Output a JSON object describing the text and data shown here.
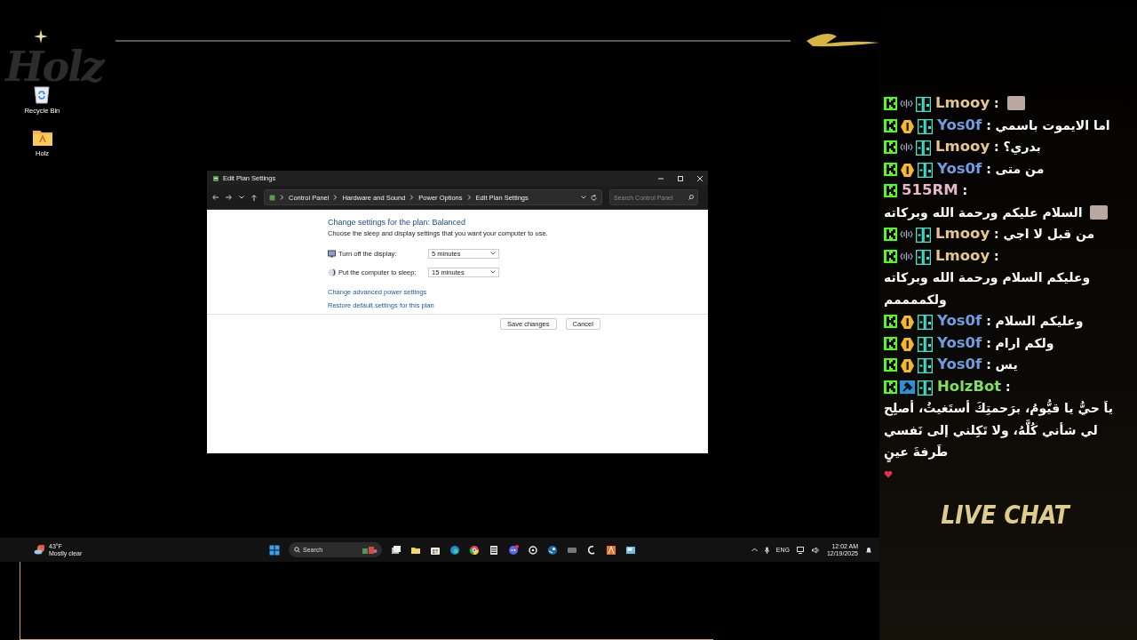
{
  "overlay": {
    "logo": "Holz",
    "live_chat": "LIVE CHAT"
  },
  "desktop": {
    "icons": [
      {
        "label": "Recycle Bin",
        "kind": "recycle"
      },
      {
        "label": "Holz",
        "kind": "folder"
      }
    ]
  },
  "window": {
    "title": "Edit Plan Settings",
    "breadcrumb": [
      "Control Panel",
      "Hardware and Sound",
      "Power Options",
      "Edit Plan Settings"
    ],
    "search": {
      "placeholder": "Search Control Panel"
    },
    "heading": "Change settings for the plan: Balanced",
    "description": "Choose the sleep and display settings that you want your computer to use.",
    "settings": [
      {
        "label": "Turn off the display:",
        "value": "5 minutes",
        "kind": "display"
      },
      {
        "label": "Put the computer to sleep:",
        "value": "15 minutes",
        "kind": "sleep"
      }
    ],
    "links": [
      "Change advanced power settings",
      "Restore default settings for this plan"
    ],
    "buttons": [
      "Save changes",
      "Cancel"
    ]
  },
  "taskbar": {
    "weather": {
      "temperature": "43°F",
      "condition": "Mostly clear"
    },
    "search": {
      "placeholder": "Search"
    },
    "language": "ENG",
    "time": "12:02 AM",
    "date": "12/19/2025"
  },
  "chat": {
    "messages": [
      {
        "badges": [
          {
            "kind": "kick"
          },
          {
            "kind": "sound"
          },
          {
            "kind": "bg"
          }
        ],
        "user": "Lmooy",
        "color": "#e6c68c",
        "separator": ":",
        "emote": {
          "kind": "image"
        }
      },
      {
        "badges": [
          {
            "kind": "kick"
          },
          {
            "kind": "coin"
          },
          {
            "kind": "bg"
          }
        ],
        "user": "Yos0f",
        "color": "#6f9de2",
        "separator": ":",
        "text": "اما الايموت باسمي"
      },
      {
        "badges": [
          {
            "kind": "kick"
          },
          {
            "kind": "sound"
          },
          {
            "kind": "bg"
          }
        ],
        "user": "Lmooy",
        "color": "#e6c68c",
        "separator": ":",
        "text": "بدري؟"
      },
      {
        "badges": [
          {
            "kind": "kick"
          },
          {
            "kind": "coin"
          },
          {
            "kind": "bg"
          }
        ],
        "user": "Yos0f",
        "color": "#6f9de2",
        "separator": ":",
        "text": "من متى"
      },
      {
        "badges": [
          {
            "kind": "kick"
          }
        ],
        "user": "515RM",
        "color": "#e8b6c8",
        "separator": ":",
        "text": "السلام عليكم ورحمة الله وبركاته",
        "emote": {
          "kind": "image"
        }
      },
      {
        "badges": [
          {
            "kind": "kick"
          },
          {
            "kind": "sound"
          },
          {
            "kind": "bg"
          }
        ],
        "user": "Lmooy",
        "color": "#e6c68c",
        "separator": ":",
        "text": "من قبل لا اجي"
      },
      {
        "badges": [
          {
            "kind": "kick"
          },
          {
            "kind": "sound"
          },
          {
            "kind": "bg"
          }
        ],
        "user": "Lmooy",
        "color": "#e6c68c",
        "separator": ":",
        "text": "وعليكم السلام ورحمة الله وبركاته ولكممممم"
      },
      {
        "badges": [
          {
            "kind": "kick"
          },
          {
            "kind": "coin"
          },
          {
            "kind": "bg"
          }
        ],
        "user": "Yos0f",
        "color": "#6f9de2",
        "separator": ":",
        "text": "وعليكم السلام"
      },
      {
        "badges": [
          {
            "kind": "kick"
          },
          {
            "kind": "coin"
          },
          {
            "kind": "bg"
          }
        ],
        "user": "Yos0f",
        "color": "#6f9de2",
        "separator": ":",
        "text": "ولكم ارام"
      },
      {
        "badges": [
          {
            "kind": "kick"
          },
          {
            "kind": "coin"
          },
          {
            "kind": "bg"
          }
        ],
        "user": "Yos0f",
        "color": "#6f9de2",
        "separator": ":",
        "text": "يس"
      },
      {
        "badges": [
          {
            "kind": "kick"
          },
          {
            "kind": "mod"
          },
          {
            "kind": "bg"
          }
        ],
        "user": "HolzBot",
        "color": "#80e05c",
        "separator": ":",
        "text": "ياَ حيُّ يا قيُّومُ، برَحمتِكَ أستَغيثُ، أصلِح لي شأني كُلَّهُ، ولا تَكِلني إلى نَفسي طَرفةَ عينٍ",
        "emote": {
          "kind": "heart"
        }
      }
    ]
  }
}
